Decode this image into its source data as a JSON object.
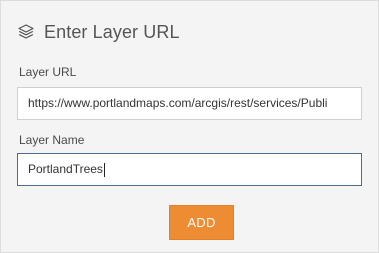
{
  "header": {
    "icon": "layers-icon",
    "title": "Enter Layer URL"
  },
  "url_field": {
    "label": "Layer URL",
    "value": "https://www.portlandmaps.com/arcgis/rest/services/Publi"
  },
  "name_field": {
    "label": "Layer Name",
    "value": "PortlandTrees"
  },
  "add_button": {
    "label": "ADD"
  },
  "colors": {
    "panel_background": "#f4f4f4",
    "accent_button": "#ee8c34",
    "focused_border": "#4a6d91"
  }
}
